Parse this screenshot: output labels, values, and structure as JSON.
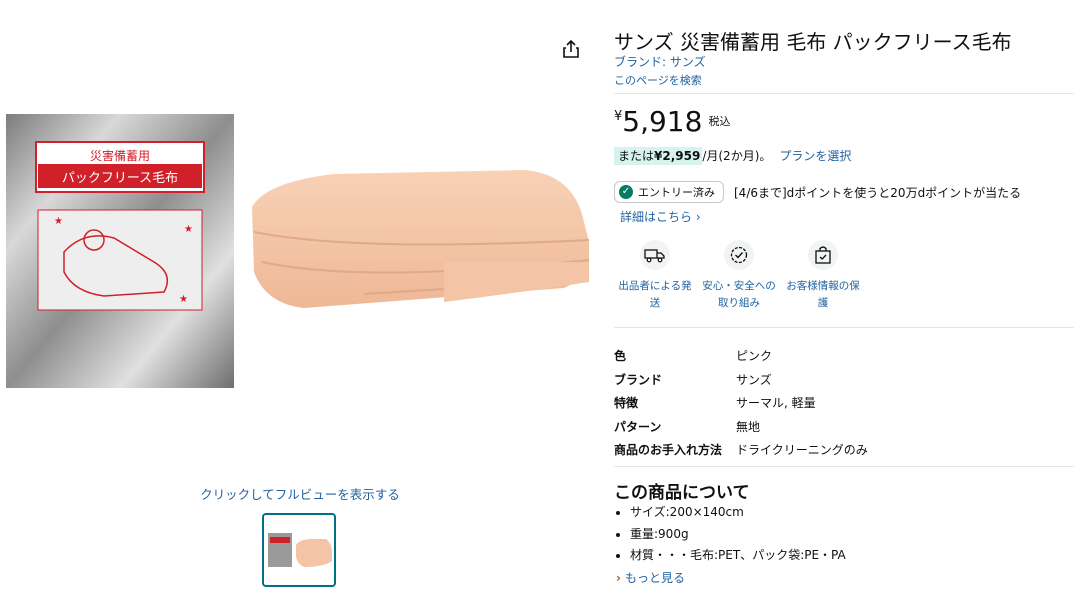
{
  "gallery": {
    "fullview_label": "クリックしてフルビューを表示する",
    "package_text_line1": "災害備蓄用",
    "package_text_line2": "パックフリース毛布",
    "icons": {
      "share": "share-icon"
    }
  },
  "product": {
    "title": "サンズ 災害備蓄用 毛布 パックフリース毛布",
    "brand_link": "ブランド: サンズ",
    "search_link": "このページを検索",
    "price_symbol": "¥",
    "price_amount": "5,918",
    "price_tax": "税込",
    "installment_prefix": "または",
    "installment_amount": "¥2,959",
    "installment_suffix": "/月(2か月)。",
    "plan_link": "プランを選択",
    "entry_badge": "エントリー済み",
    "promo_text": "[4/6まで]dポイントを使うと20万dポイントが当たる",
    "detail_link": "詳細はこちら",
    "features": [
      {
        "label": "出品者による発送",
        "icon": "delivery-truck-icon"
      },
      {
        "label": "安心・安全への取り組み",
        "icon": "safety-badge-icon"
      },
      {
        "label": "お客様情報の保護",
        "icon": "secure-bag-icon"
      }
    ],
    "attributes": [
      {
        "key": "色",
        "value": "ピンク"
      },
      {
        "key": "ブランド",
        "value": "サンズ"
      },
      {
        "key": "特徴",
        "value": "サーマル, 軽量"
      },
      {
        "key": "パターン",
        "value": "無地"
      },
      {
        "key": "商品のお手入れ方法",
        "value": "ドライクリーニングのみ"
      }
    ],
    "about_title": "この商品について",
    "bullets": [
      "サイズ:200×140cm",
      "重量:900g",
      "材質・・・毛布:PET、パック袋:PE・PA"
    ],
    "more_link": "もっと見る"
  },
  "colors": {
    "link": "#2162a1",
    "installment_highlight": "#d7f3ee",
    "check_green": "#067d62",
    "blanket": "#f6c7a8",
    "thumb_border": "#007185"
  }
}
